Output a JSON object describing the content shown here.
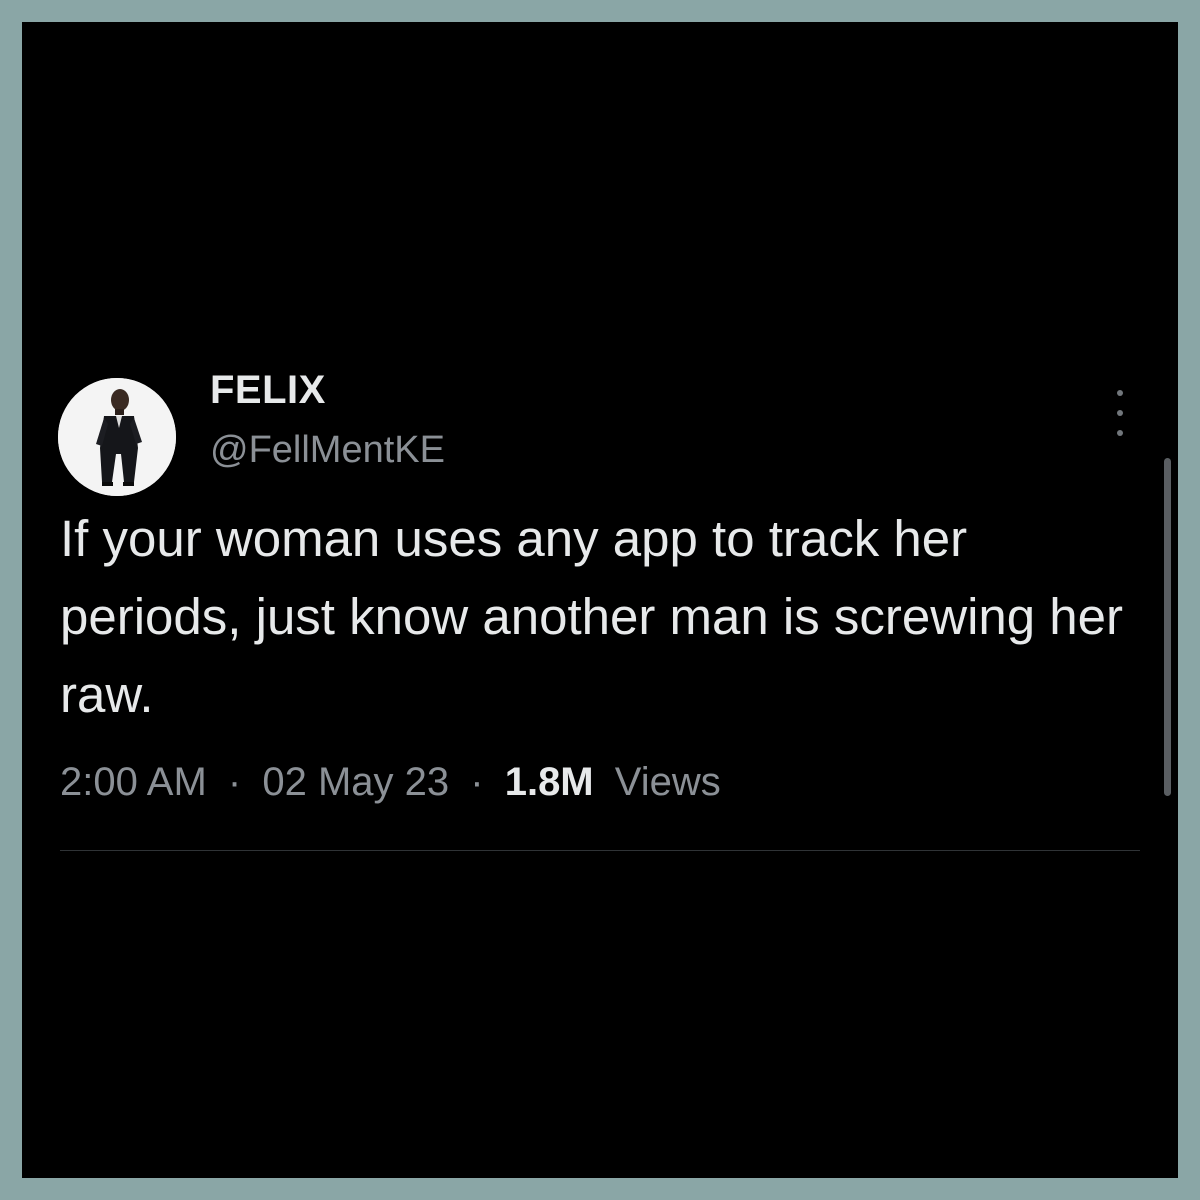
{
  "tweet": {
    "author": {
      "display_name": "FELIX",
      "handle": "@FellMentKE",
      "avatar_icon": "profile-photo"
    },
    "text": "If your woman uses any app to track her periods, just know another man is screwing her raw.",
    "time": "2:00 AM",
    "separator": "·",
    "date": "02 May 23",
    "views_count": "1.8M",
    "views_label": "Views",
    "more_icon": "more-vertical-icon"
  },
  "colors": {
    "background": "#000000",
    "frame_border": "#8aa6a6",
    "primary_text": "#e7e9ea",
    "secondary_text": "#8b9096"
  }
}
